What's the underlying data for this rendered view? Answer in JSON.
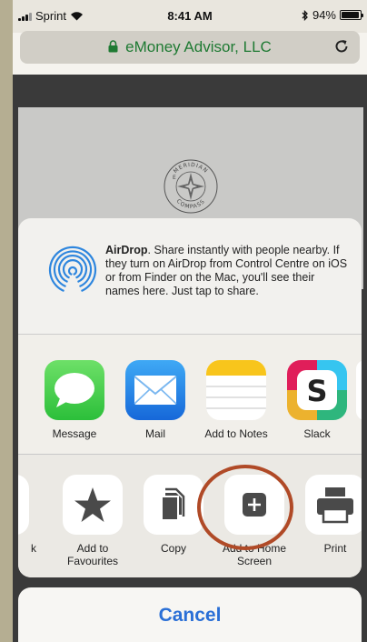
{
  "status_bar": {
    "carrier": "Sprint",
    "time": "8:41 AM",
    "battery": "94%",
    "battery_level": 0.94
  },
  "url_bar": {
    "site": "eMoney Advisor, LLC"
  },
  "page": {
    "logo_top": "MERIDIAN",
    "logo_bottom": "COMPASS",
    "logo_e": "E"
  },
  "airdrop": {
    "title": "AirDrop",
    "description": ". Share instantly with people nearby. If they turn on AirDrop from Control Centre on iOS or from Finder on the Mac, you'll see their names here. Just tap to share."
  },
  "apps": [
    {
      "label": "Message",
      "icon": "message-icon"
    },
    {
      "label": "Mail",
      "icon": "mail-icon"
    },
    {
      "label": "Add to Notes",
      "icon": "notes-icon"
    },
    {
      "label": "Slack",
      "icon": "slack-icon"
    }
  ],
  "actions": [
    {
      "label": "k",
      "icon": "bookmark-icon"
    },
    {
      "label": "Add to Favourites",
      "icon": "star-icon"
    },
    {
      "label": "Copy",
      "icon": "copy-icon"
    },
    {
      "label": "Add to Home Screen",
      "icon": "add-icon"
    },
    {
      "label": "Print",
      "icon": "print-icon"
    }
  ],
  "cancel_label": "Cancel",
  "colors": {
    "url_text": "#1f7a33",
    "cancel": "#2a6fd6",
    "highlight_ring": "#b04a27",
    "airdrop_blue": "#2e86de"
  }
}
